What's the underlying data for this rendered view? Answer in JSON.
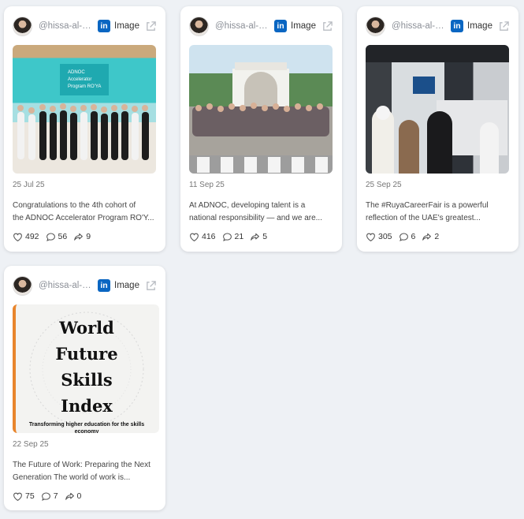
{
  "colors": {
    "background": "#eef1f5",
    "linkedin_brand": "#0a66c2",
    "card": "#ffffff"
  },
  "icons": [
    "linkedin-icon",
    "external-link-icon",
    "heart-icon",
    "comment-icon",
    "share-icon"
  ],
  "cards": [
    {
      "handle": "@hissa-al-…",
      "platform_badge": "in",
      "type": "Image",
      "date": "25 Jul 25",
      "text_line1": "Congratulations to the 4th cohort of",
      "text_line2": "the ADNOC Accelerator Program RO'Y...",
      "image_caption_lines": [
        "ADNOC",
        "Accelerator",
        "Program RO'YA"
      ],
      "likes": "492",
      "comments": "56",
      "shares": "9"
    },
    {
      "handle": "@hissa-al-…",
      "platform_badge": "in",
      "type": "Image",
      "date": "11 Sep 25",
      "text_line1": "At ADNOC, developing talent is a",
      "text_line2": "national responsibility — and we are...",
      "likes": "416",
      "comments": "21",
      "shares": "5"
    },
    {
      "handle": "@hissa-al-…",
      "platform_badge": "in",
      "type": "Image",
      "date": "25 Sep 25",
      "text_line1": "The #RuyaCareerFair is a powerful",
      "text_line2": "reflection of the UAE's greatest...",
      "likes": "305",
      "comments": "6",
      "shares": "2"
    },
    {
      "handle": "@hissa-al-…",
      "platform_badge": "in",
      "type": "Image",
      "date": "22 Sep 25",
      "text_line1": "The Future of Work: Preparing the Next",
      "text_line2": "Generation The world of work is...",
      "image_title_lines": [
        "World",
        "Future",
        "Skills",
        "Index"
      ],
      "image_subtitle": "Transforming higher education for the skills economy",
      "likes": "75",
      "comments": "7",
      "shares": "0"
    }
  ]
}
